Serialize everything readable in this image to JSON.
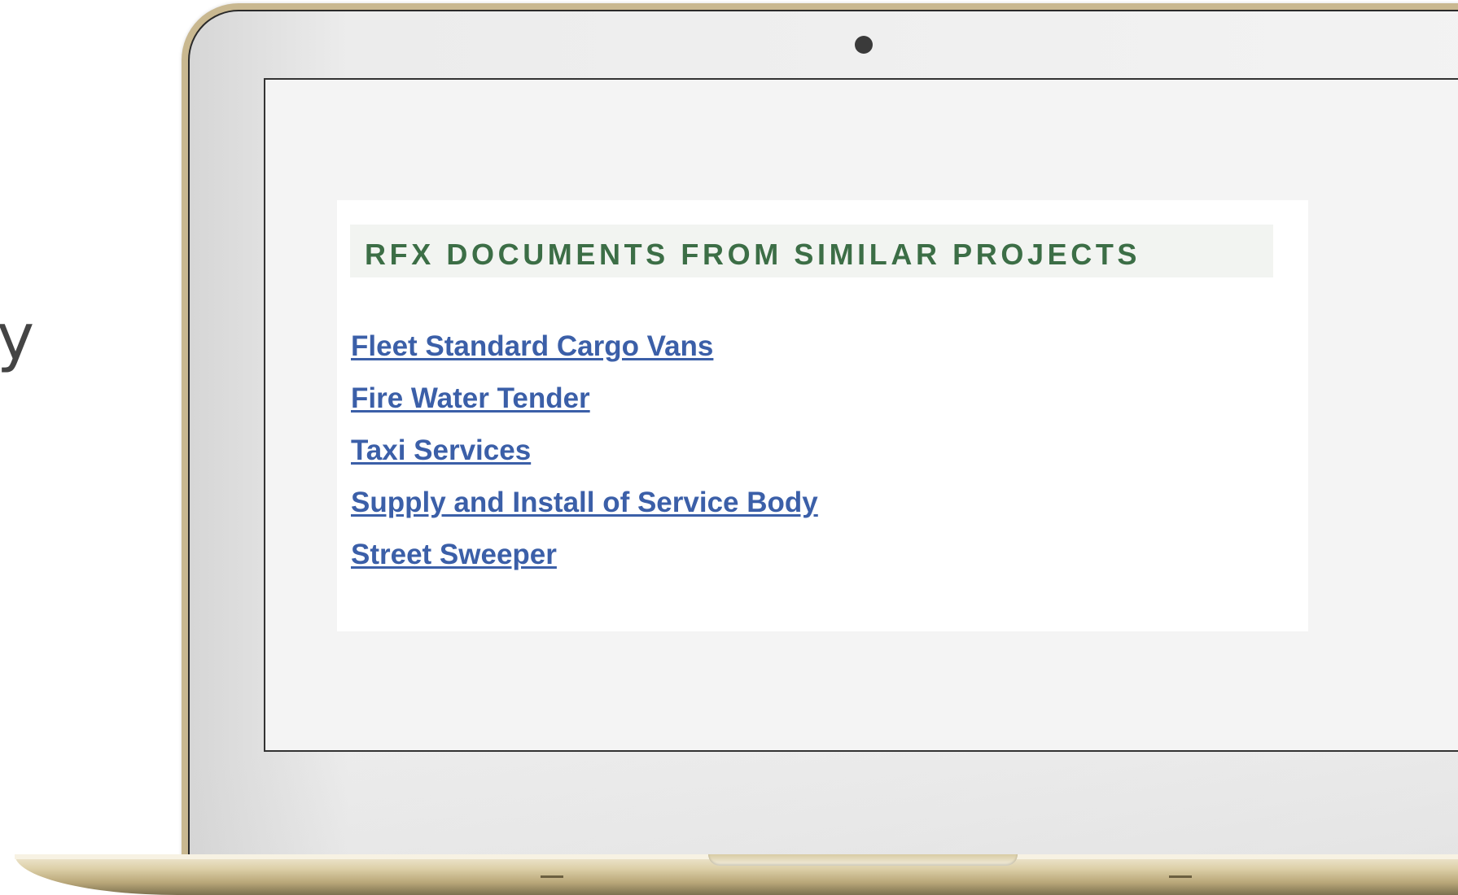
{
  "side_text": "y",
  "panel": {
    "title": "RFX DOCUMENTS FROM SIMILAR PROJECTS",
    "links": [
      "Fleet Standard Cargo Vans",
      "Fire Water Tender",
      "Taxi Services",
      "Supply and Install of Service Body",
      "Street Sweeper"
    ]
  },
  "colors": {
    "title": "#3c6e46",
    "link": "#3b5fa8",
    "laptop_frame": "#c9b890"
  }
}
